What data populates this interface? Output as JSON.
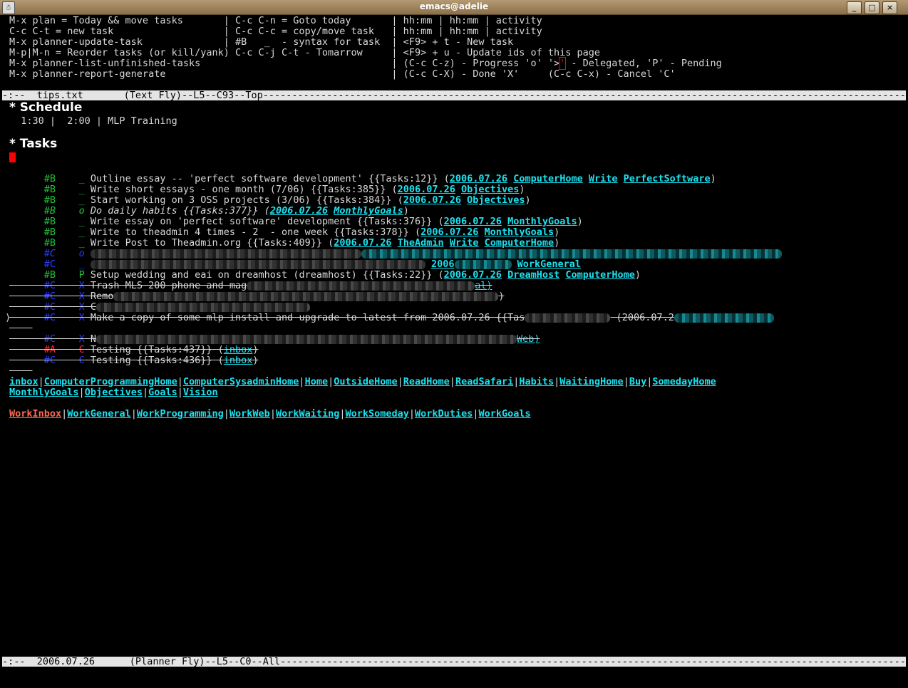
{
  "window": {
    "title": "emacs@adelie",
    "buttons": [
      "_",
      "□",
      "×"
    ],
    "app_icon": "☃"
  },
  "tips": [
    "M-x plan = Today && move tasks       | C-c C-n = Goto today       | hh:mm | hh:mm | activity",
    "C-c C-t = new task                   | C-c C-c = copy/move task   | hh:mm | hh:mm | activity",
    "M-x planner-update-task              | #B   _  - syntax for task  | <F9> + t - New task",
    "M-p|M-n = Reorder tasks (or kill/yank) C-c C-j C-t - Tomarrow     | <F9> + u - Update ids of this page",
    "M-x planner-list-unfinished-tasks                                 | (C-c C-z) - Progress 'o' '>",
    "M-x planner-report-generate                                       | (C-c C-X) - Done 'X'     (C-c C-x) - Cancel 'C'"
  ],
  "tips_line5_tail": " - Delegated, 'P' - Pending",
  "mode_top": "-:--  tips.txt       (Text Fly)--L5--C93--Top--------------------------------------------------------------------------------------------------------------------------------------------",
  "schedule": {
    "heading": "* Schedule",
    "entry": "  1:30 |  2:00 | MLP Training"
  },
  "tasks_heading": "* Tasks",
  "tasks": [
    {
      "pri": "#B",
      "st": "_",
      "text": "Outline essay -- 'perfect software development' {{Tasks:12}} (",
      "date": "2006.07.26",
      "links": [
        "ComputerHome",
        "Write",
        "PerfectSoftware"
      ]
    },
    {
      "pri": "#B",
      "st": "_",
      "text": "Write short essays - one month (7/06) {{Tasks:385}} (",
      "date": "2006.07.26",
      "links": [
        "Objectives"
      ]
    },
    {
      "pri": "#B",
      "st": "_",
      "text": "Start working on 3 OSS projects (3/06) {{Tasks:384}} (",
      "date": "2006.07.26",
      "links": [
        "Objectives"
      ]
    },
    {
      "pri": "#B",
      "st": "o",
      "text": "Do daily habits {{Tasks:377}} (",
      "date": "2006.07.26",
      "links": [
        "MonthlyGoals"
      ]
    },
    {
      "pri": "#B",
      "st": "_",
      "text": "Write essay on 'perfect software' development {{Tasks:376}} (",
      "date": "2006.07.26",
      "links": [
        "MonthlyGoals"
      ]
    },
    {
      "pri": "#B",
      "st": "_",
      "text": "Write to theadmin 4 times - 2  - one week {{Tasks:378}} (",
      "date": "2006.07.26",
      "links": [
        "MonthlyGoals"
      ]
    },
    {
      "pri": "#B",
      "st": "_",
      "text": "Write Post to Theadmin.org {{Tasks:409}} (",
      "date": "2006.07.26",
      "links": [
        "TheAdmin",
        "Write",
        "ComputerHome"
      ]
    },
    {
      "pri": "#C",
      "st": "o"
    },
    {
      "pri": "#C",
      "st": "_",
      "links": [
        "2006",
        "WorkGeneral"
      ]
    },
    {
      "pri": "#B",
      "st": "P",
      "text": "Setup wedding and eai on dreamhost (dreamhost) {{Tasks:22}} (",
      "date": "2006.07.26",
      "links": [
        "DreamHost",
        "ComputerHome"
      ]
    },
    {
      "pri": "#C",
      "st": "X",
      "text": "Trash MLS 200 phone and mag",
      "links": [
        "al)"
      ]
    },
    {
      "pri": "#C",
      "st": "X",
      "text": "Remo"
    },
    {
      "pri": "#C",
      "st": "X",
      "text": "C"
    },
    {
      "pri": "#C",
      "st": "X",
      "text": "Make a copy of some mlp install and upgrade to latest from 2006.07.26 {{Tas",
      "date": "2006.07.2"
    },
    {
      "pri": "#C",
      "st": "X",
      "text": "N",
      "links": [
        "Web)"
      ]
    },
    {
      "pri": "#A",
      "st": "C",
      "text": "Testing {{Tasks:437}} (",
      "links": [
        "inbox"
      ]
    },
    {
      "pri": "#C",
      "st": "C",
      "text": "Testing {{Tasks:436}} (",
      "links": [
        "inbox"
      ]
    }
  ],
  "nav_row1": [
    "inbox",
    "ComputerProgrammingHome",
    "ComputerSysadminHome",
    "Home",
    "OutsideHome",
    "ReadHome",
    "ReadSafari",
    "Habits",
    "WaitingHome",
    "Buy",
    "SomedayHome"
  ],
  "nav_row2": [
    "MonthlyGoals",
    "Objectives",
    "Goals",
    "Vision"
  ],
  "nav_row3": [
    "WorkInbox",
    "WorkGeneral",
    "WorkProgramming",
    "WorkWeb",
    "WorkWaiting",
    "WorkSomeday",
    "WorkDuties",
    "WorkGoals"
  ],
  "mode_bottom": "-:--  2006.07.26      (Planner Fly)--L5--C0--All-----------------------------------------------------------------------------------------------------------------------------------------",
  "colors": {
    "link": "#1ce1ef",
    "priority_b": "#22c03a",
    "priority_c": "#2a3cff",
    "priority_a": "#ff2a2a",
    "workinbox": "#ff6a50"
  }
}
